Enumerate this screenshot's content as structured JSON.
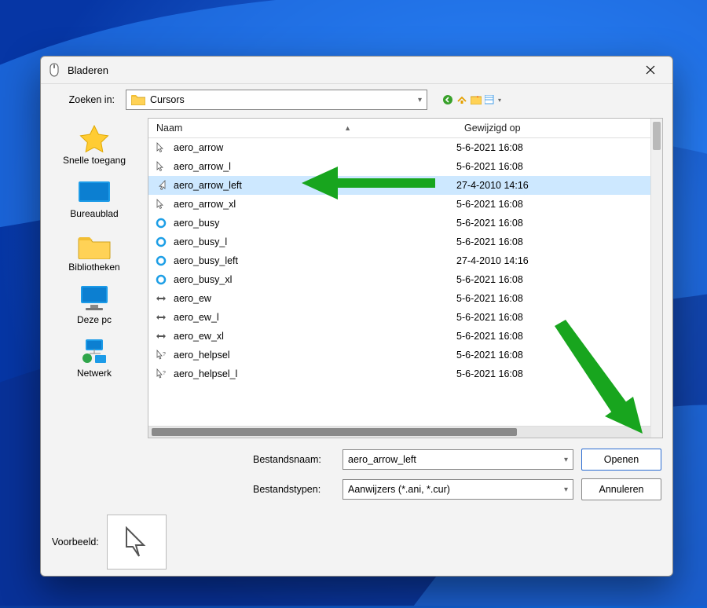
{
  "title": "Bladeren",
  "lookin": {
    "label": "Zoeken in:",
    "folder": "Cursors"
  },
  "sidebar": [
    {
      "label": "Snelle toegang"
    },
    {
      "label": "Bureaublad"
    },
    {
      "label": "Bibliotheken"
    },
    {
      "label": "Deze pc"
    },
    {
      "label": "Netwerk"
    }
  ],
  "columns": {
    "name": "Naam",
    "date": "Gewijzigd op"
  },
  "files": [
    {
      "name": "aero_arrow",
      "date": "5-6-2021 16:08",
      "icon": "cursor",
      "selected": false
    },
    {
      "name": "aero_arrow_l",
      "date": "5-6-2021 16:08",
      "icon": "cursor",
      "selected": false
    },
    {
      "name": "aero_arrow_left",
      "date": "27-4-2010 14:16",
      "icon": "cursor-left",
      "selected": true
    },
    {
      "name": "aero_arrow_xl",
      "date": "5-6-2021 16:08",
      "icon": "cursor",
      "selected": false
    },
    {
      "name": "aero_busy",
      "date": "5-6-2021 16:08",
      "icon": "busy",
      "selected": false
    },
    {
      "name": "aero_busy_l",
      "date": "5-6-2021 16:08",
      "icon": "busy",
      "selected": false
    },
    {
      "name": "aero_busy_left",
      "date": "27-4-2010 14:16",
      "icon": "busy",
      "selected": false
    },
    {
      "name": "aero_busy_xl",
      "date": "5-6-2021 16:08",
      "icon": "busy",
      "selected": false
    },
    {
      "name": "aero_ew",
      "date": "5-6-2021 16:08",
      "icon": "ew",
      "selected": false
    },
    {
      "name": "aero_ew_l",
      "date": "5-6-2021 16:08",
      "icon": "ew",
      "selected": false
    },
    {
      "name": "aero_ew_xl",
      "date": "5-6-2021 16:08",
      "icon": "ew",
      "selected": false
    },
    {
      "name": "aero_helpsel",
      "date": "5-6-2021 16:08",
      "icon": "help",
      "selected": false
    },
    {
      "name": "aero_helpsel_l",
      "date": "5-6-2021 16:08",
      "icon": "help",
      "selected": false
    }
  ],
  "filename_label": "Bestandsnaam:",
  "filetype_label": "Bestandstypen:",
  "filename_value": "aero_arrow_left",
  "filetype_value": "Aanwijzers (*.ani, *.cur)",
  "open_btn": "Openen",
  "cancel_btn": "Annuleren",
  "preview_label": "Voorbeeld:"
}
